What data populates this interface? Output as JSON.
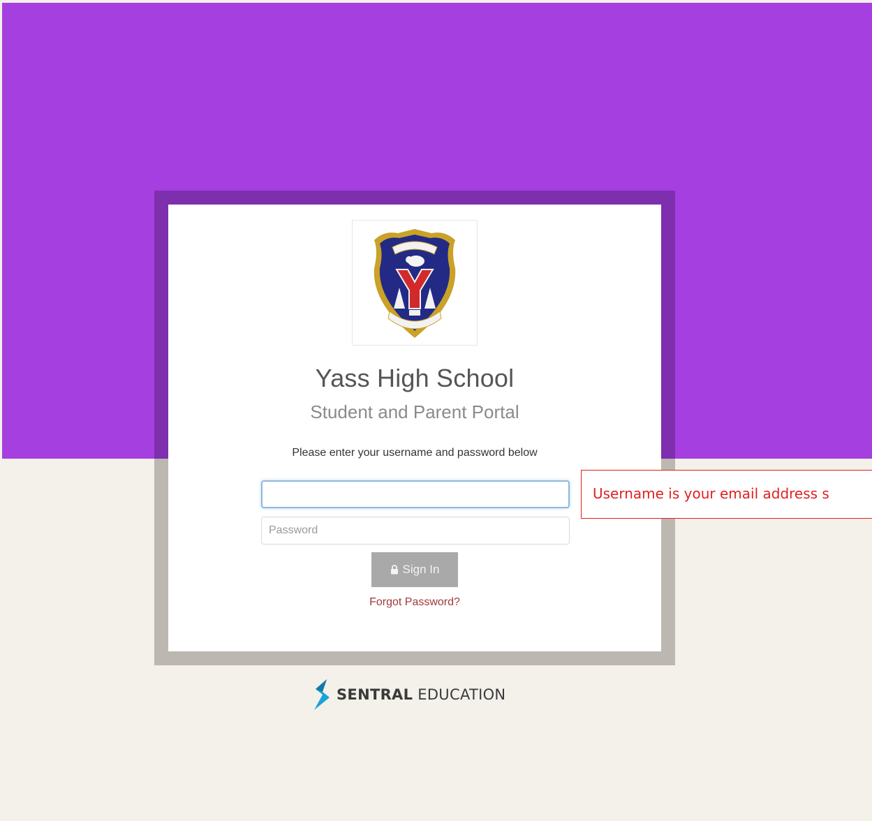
{
  "school": {
    "name": "Yass High School",
    "portal": "Student and Parent Portal"
  },
  "login": {
    "instruction": "Please enter your username and password below",
    "username_value": "",
    "username_placeholder": "",
    "password_placeholder": "Password",
    "signin_label": "Sign In",
    "forgot_label": "Forgot Password?"
  },
  "callout": {
    "text": "Username is your email address s"
  },
  "brand": {
    "bold": "SENTRAL",
    "rest": "EDUCATION"
  },
  "icons": {
    "signin": "lock-icon",
    "logo": "school-crest-icon",
    "brand": "sentral-s-icon"
  },
  "colors": {
    "top_band": "#a63fdf",
    "frame_top": "#7e2fae",
    "frame_bottom": "#bcb8b1",
    "background": "#f3f1ea",
    "signin_button": "#a9a9a9",
    "forgot_link": "#a0393a",
    "callout": "#e02020",
    "brand_accent": "#1aa3d9"
  }
}
